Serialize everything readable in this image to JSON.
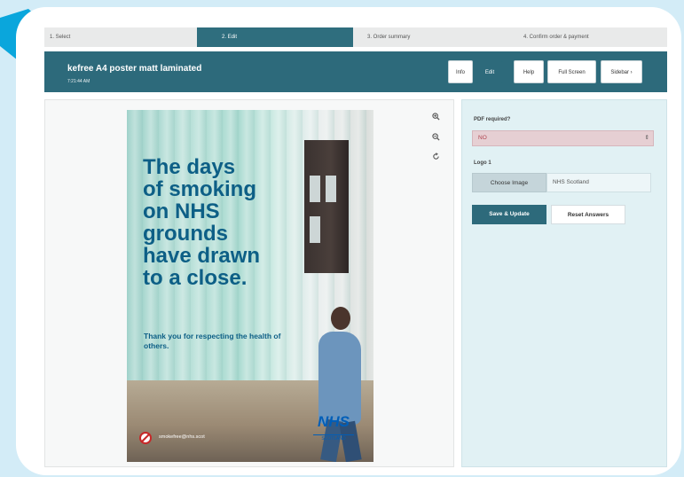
{
  "steps": [
    "1. Select",
    "2. Edit",
    "3. Order summary",
    "4. Confirm order & payment"
  ],
  "header": {
    "title": "kefree A4 poster matt laminated",
    "time": "7:21:44 AM",
    "buttons": [
      "Info",
      "Edit",
      "Help",
      "Full Screen",
      "Sidebar ›"
    ]
  },
  "viewer_tools": {
    "zoom_in": "zoom-in-icon",
    "zoom_out": "zoom-out-icon",
    "reset": "refresh-icon"
  },
  "poster": {
    "headline_lines": [
      "The days",
      "of smoking",
      "on NHS",
      "grounds",
      "have drawn",
      "to a close."
    ],
    "subline": "Thank you for respecting the health of others.",
    "web": "smokefree@nhs.scot",
    "logo_main": "NHS",
    "logo_sub": "SCOTLAND"
  },
  "form": {
    "pdf_label": "PDF required?",
    "pdf_value": "NO",
    "logo_label": "Logo 1",
    "choose_image": "Choose Image",
    "logo_value": "NHS Scotland",
    "save": "Save & Update",
    "reset": "Reset Answers"
  },
  "colors": {
    "primary": "#2d6a7b",
    "arrow": "#0aa6dc",
    "background": "#d3ecf7",
    "poster_text": "#0d5f86"
  }
}
